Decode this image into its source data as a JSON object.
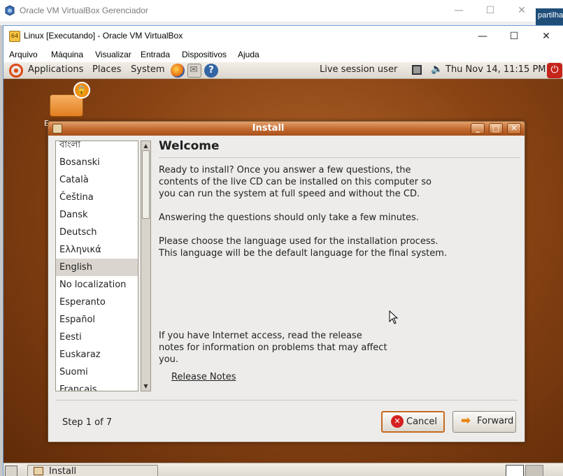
{
  "host": {
    "title": "Oracle VM VirtualBox Gerenciador",
    "right_strip_text": "partilha",
    "controls": {
      "minimize": "—",
      "maximize": "☐",
      "close": "✕"
    }
  },
  "vm_window": {
    "title": "Linux [Executando] - Oracle VM VirtualBox",
    "menu": [
      "Arquivo",
      "Máquina",
      "Visualizar",
      "Entrada",
      "Dispositivos",
      "Ajuda"
    ],
    "controls": {
      "minimize": "—",
      "maximize": "☐",
      "close": "✕"
    }
  },
  "gnome_panel": {
    "menus": [
      "Applications",
      "Places",
      "System"
    ],
    "session_user": "Live session user",
    "clock": "Thu Nov 14, 11:15 PM",
    "icons": [
      "ubuntu-logo",
      "firefox",
      "mail",
      "help",
      "network",
      "volume",
      "power"
    ]
  },
  "desktop_icon": {
    "label": "E"
  },
  "install_dialog": {
    "title": "Install",
    "heading": "Welcome",
    "languages_partial": "বাংলা",
    "languages": [
      "Bosanski",
      "Català",
      "Čeština",
      "Dansk",
      "Deutsch",
      "Ελληνικά",
      "English",
      "No localization",
      "Esperanto",
      "Español",
      "Eesti",
      "Euskaraz",
      "Suomi",
      "Français"
    ],
    "selected_language": "English",
    "paragraph1_lines": [
      "Ready to install? Once you answer a few questions, the",
      "contents of the live CD can be installed on this computer so",
      "you can run the system at full speed and without the CD."
    ],
    "paragraph2": "Answering the questions should only take a few minutes.",
    "paragraph3_lines": [
      "Please choose the language used for the installation process.",
      "This language will be the default language for the final system."
    ],
    "paragraph4_lines": [
      "If you have Internet access, read the release",
      "notes for information on problems that may affect",
      "you."
    ],
    "release_notes_link": "Release Notes",
    "step_label": "Step 1 of 7",
    "cancel_label": "Cancel",
    "forward_label": "Forward"
  },
  "taskbar": {
    "task_label": "Install"
  },
  "colors": {
    "accent_orange": "#c2682d",
    "panel_bg": "#dcd8cf",
    "desktop_brown": "#8a4414"
  }
}
